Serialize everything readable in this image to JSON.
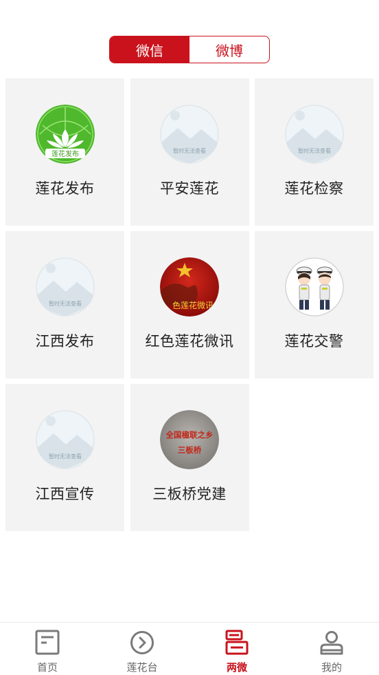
{
  "switch": {
    "options": [
      "微信",
      "微博"
    ],
    "active_index": 0
  },
  "accounts": [
    {
      "name": "莲花发布",
      "avatar": "lotus-logo",
      "avatar_text": "莲花发布"
    },
    {
      "name": "平安莲花",
      "avatar": "placeholder-image",
      "avatar_text": "暂时无法查看"
    },
    {
      "name": "莲花检察",
      "avatar": "placeholder-image",
      "avatar_text": "暂时无法查看"
    },
    {
      "name": "江西发布",
      "avatar": "placeholder-image",
      "avatar_text": "暂时无法查看"
    },
    {
      "name": "红色莲花微讯",
      "avatar": "red-star-photo",
      "avatar_text": "色莲花微讯"
    },
    {
      "name": "莲花交警",
      "avatar": "traffic-police-cartoon",
      "avatar_text": ""
    },
    {
      "name": "江西宣传",
      "avatar": "placeholder-image",
      "avatar_text": "暂时无法查看"
    },
    {
      "name": "三板桥党建",
      "avatar": "stone-plaque",
      "avatar_text": "全国楹联之乡 三板桥"
    }
  ],
  "bottom_nav": {
    "items": [
      {
        "label": "首页",
        "icon": "home-doc-icon"
      },
      {
        "label": "莲花台",
        "icon": "play-circle-icon"
      },
      {
        "label": "两微",
        "icon": "weibo-wechat-icon"
      },
      {
        "label": "我的",
        "icon": "user-icon"
      }
    ],
    "active_index": 2
  },
  "colors": {
    "accent": "#c9121c",
    "cell_bg": "#f3f3f3",
    "nav_inactive": "#666666"
  }
}
